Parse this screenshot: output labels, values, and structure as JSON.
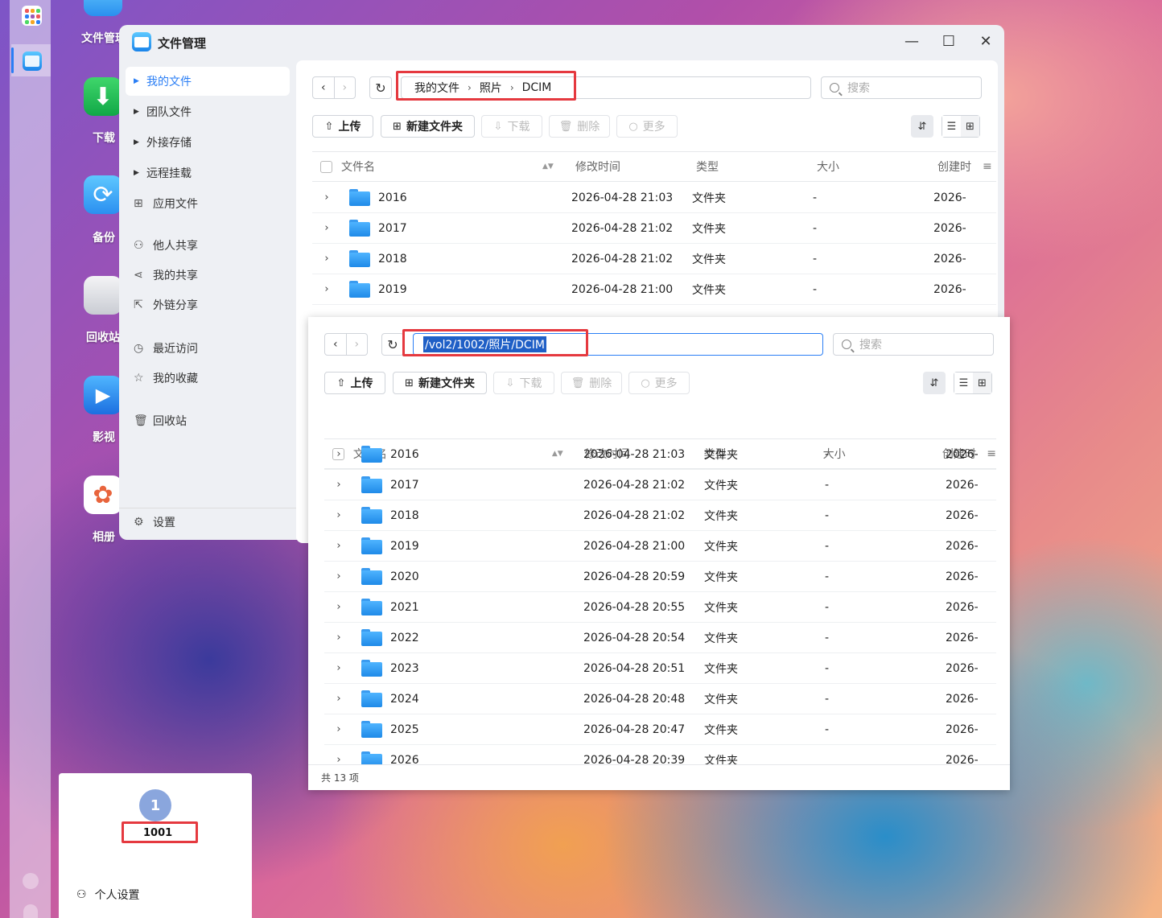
{
  "desktop": {
    "icons": [
      {
        "label": "文件管理"
      },
      {
        "label": "下载"
      },
      {
        "label": "备份"
      },
      {
        "label": "回收站"
      },
      {
        "label": "影视"
      },
      {
        "label": "相册"
      }
    ]
  },
  "window1": {
    "title": "文件管理",
    "controls": {
      "minimize": "—",
      "maximize": "☐",
      "close": "✕"
    },
    "sidebar": {
      "items": [
        {
          "label": "我的文件"
        },
        {
          "label": "团队文件"
        },
        {
          "label": "外接存储"
        },
        {
          "label": "远程挂载"
        },
        {
          "label": "应用文件"
        },
        {
          "label": "他人共享"
        },
        {
          "label": "我的共享"
        },
        {
          "label": "外链分享"
        },
        {
          "label": "最近访问"
        },
        {
          "label": "我的收藏"
        },
        {
          "label": "回收站"
        }
      ],
      "settings": "设置"
    },
    "breadcrumb": [
      "我的文件",
      "照片",
      "DCIM"
    ],
    "search_placeholder": "搜索",
    "toolbar": {
      "upload": "上传",
      "new_folder": "新建文件夹",
      "download": "下载",
      "delete": "删除",
      "more": "更多"
    },
    "columns": {
      "name": "文件名",
      "modified": "修改时间",
      "type": "类型",
      "size": "大小",
      "created": "创建时"
    },
    "rows": [
      {
        "name": "2016",
        "modified": "2026-04-28 21:03",
        "type": "文件夹",
        "size": "-",
        "created": "2026-("
      },
      {
        "name": "2017",
        "modified": "2026-04-28 21:02",
        "type": "文件夹",
        "size": "-",
        "created": "2026-("
      },
      {
        "name": "2018",
        "modified": "2026-04-28 21:02",
        "type": "文件夹",
        "size": "-",
        "created": "2026-("
      },
      {
        "name": "2019",
        "modified": "2026-04-28 21:00",
        "type": "文件夹",
        "size": "-",
        "created": "2026-("
      }
    ]
  },
  "window2": {
    "path": "/vol2/1002/照片/DCIM",
    "search_placeholder": "搜索",
    "toolbar": {
      "upload": "上传",
      "new_folder": "新建文件夹",
      "download": "下载",
      "delete": "删除",
      "more": "更多"
    },
    "columns": {
      "name": "文件名",
      "modified": "修改时间",
      "type": "类型",
      "size": "大小",
      "created": "创建时"
    },
    "rows": [
      {
        "name": "2016",
        "modified": "2026-04-28 21:03",
        "type": "文件夹",
        "size": "-",
        "created": "2026-("
      },
      {
        "name": "2017",
        "modified": "2026-04-28 21:02",
        "type": "文件夹",
        "size": "-",
        "created": "2026-("
      },
      {
        "name": "2018",
        "modified": "2026-04-28 21:02",
        "type": "文件夹",
        "size": "-",
        "created": "2026-("
      },
      {
        "name": "2019",
        "modified": "2026-04-28 21:00",
        "type": "文件夹",
        "size": "-",
        "created": "2026-("
      },
      {
        "name": "2020",
        "modified": "2026-04-28 20:59",
        "type": "文件夹",
        "size": "-",
        "created": "2026-("
      },
      {
        "name": "2021",
        "modified": "2026-04-28 20:55",
        "type": "文件夹",
        "size": "-",
        "created": "2026-("
      },
      {
        "name": "2022",
        "modified": "2026-04-28 20:54",
        "type": "文件夹",
        "size": "-",
        "created": "2026-("
      },
      {
        "name": "2023",
        "modified": "2026-04-28 20:51",
        "type": "文件夹",
        "size": "-",
        "created": "2026-("
      },
      {
        "name": "2024",
        "modified": "2026-04-28 20:48",
        "type": "文件夹",
        "size": "-",
        "created": "2026-("
      },
      {
        "name": "2025",
        "modified": "2026-04-28 20:47",
        "type": "文件夹",
        "size": "-",
        "created": "2026-("
      },
      {
        "name": "2026",
        "modified": "2026-04-28 20:39",
        "type": "文件夹",
        "size": "",
        "created": "2026-("
      }
    ],
    "footer": "共 13 项"
  },
  "user": {
    "avatar_initial": "1",
    "name": "1001",
    "settings": "个人设置"
  },
  "colors": {
    "accent": "#2a7ef5",
    "highlight_box": "#e5393f",
    "folder": "#2f9cf2"
  }
}
